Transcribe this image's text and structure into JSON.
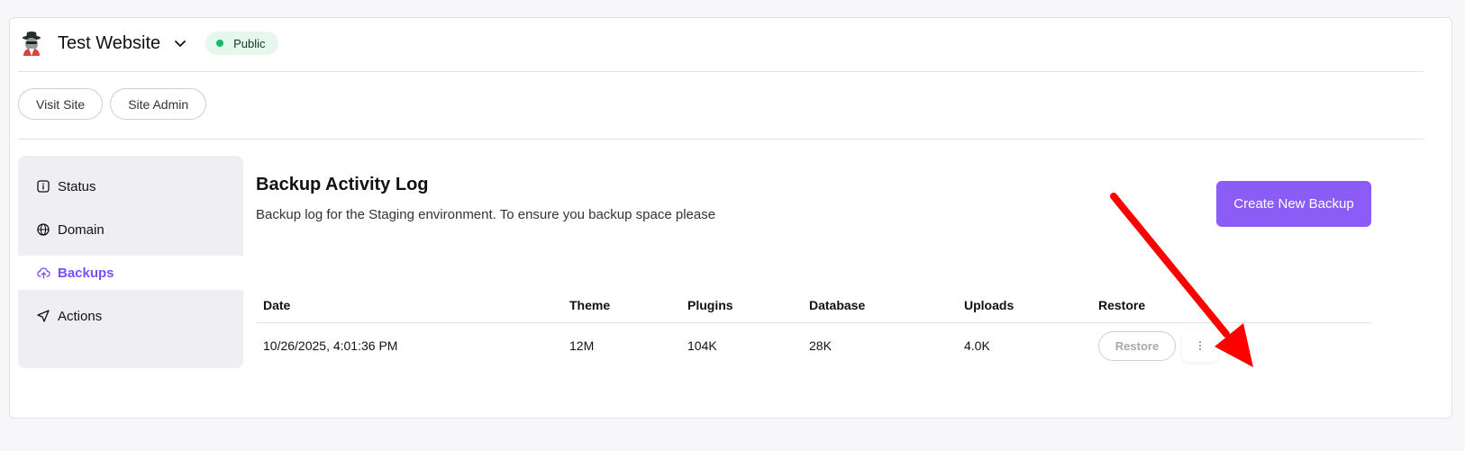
{
  "site": {
    "name": "Test Website",
    "status": "Public",
    "status_color": "#19b86a",
    "avatar_icon": "spy-avatar-icon"
  },
  "actions": {
    "visit_site": "Visit Site",
    "site_admin": "Site Admin"
  },
  "sidebar": {
    "items": [
      {
        "label": "Status",
        "icon": "info-square-icon",
        "active": false
      },
      {
        "label": "Domain",
        "icon": "globe-icon",
        "active": false
      },
      {
        "label": "Backups",
        "icon": "cloud-upload-icon",
        "active": true
      },
      {
        "label": "Actions",
        "icon": "send-icon",
        "active": false
      }
    ]
  },
  "main": {
    "title": "Backup Activity Log",
    "description": "Backup log for the Staging environment. To ensure you backup space please",
    "create_button": "Create New Backup",
    "accent_color": "#8b5cf6"
  },
  "table": {
    "headers": [
      "Date",
      "Theme",
      "Plugins",
      "Database",
      "Uploads",
      "Restore"
    ],
    "rows": [
      {
        "date": "10/26/2025, 4:01:36 PM",
        "theme": "12M",
        "plugins": "104K",
        "database": "28K",
        "uploads": "4.0K",
        "restore_label": "Restore"
      }
    ]
  },
  "annotation": {
    "type": "red-arrow",
    "color": "#ff0000",
    "target": "row-menu-button"
  }
}
